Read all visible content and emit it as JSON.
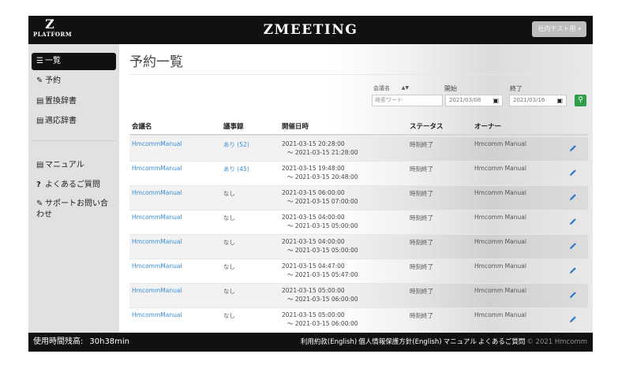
{
  "header": {
    "logo_letter": "Z",
    "logo_sub": "PLATFORM",
    "app_title": "ZMEETING",
    "user_menu_label": "社内テスト用"
  },
  "sidebar": {
    "items": [
      {
        "icon": "list-icon",
        "glyph": "☰",
        "label": "一覧",
        "active": true
      },
      {
        "icon": "pencil-icon",
        "glyph": "✎",
        "label": "予約"
      },
      {
        "icon": "book-icon",
        "glyph": "▤",
        "label": "置換辞書"
      },
      {
        "icon": "book-icon",
        "glyph": "▤",
        "label": "適応辞書"
      },
      {
        "icon": "book-icon",
        "glyph": "▤",
        "label": "マニュアル"
      },
      {
        "icon": "question-icon",
        "glyph": "?",
        "label": "よくあるご質問"
      },
      {
        "icon": "edit-box-icon",
        "glyph": "✎",
        "label": "サポートお問い合わせ"
      }
    ]
  },
  "main": {
    "title": "予約一覧",
    "filters": {
      "field_select": "会議名",
      "keyword_placeholder": "検索ワード",
      "start_label": "開始",
      "start_value": "2021/03/08",
      "end_label": "終了",
      "end_value": "2021/03/16"
    },
    "table": {
      "columns": [
        "会議名",
        "議事録",
        "開催日時",
        "ステータス",
        "オーナー"
      ],
      "rows": [
        {
          "name": "HmcommManual",
          "minutes": "あり (52)",
          "minutes_link": true,
          "start": "2021-03-15 20:28:00",
          "end": "～ 2021-03-15 21:28:00",
          "status": "時刻終了",
          "owner": "Hmcomm Manual"
        },
        {
          "name": "HmcommManual",
          "minutes": "あり (45)",
          "minutes_link": true,
          "start": "2021-03-15 19:48:00",
          "end": "～ 2021-03-15 20:48:00",
          "status": "時刻終了",
          "owner": "Hmcomm Manual"
        },
        {
          "name": "HmcommManual",
          "minutes": "なし",
          "minutes_link": false,
          "start": "2021-03-15 06:00:00",
          "end": "～ 2021-03-15 07:00:00",
          "status": "時刻終了",
          "owner": "Hmcomm Manual"
        },
        {
          "name": "HmcommManual",
          "minutes": "なし",
          "minutes_link": false,
          "start": "2021-03-15 04:00:00",
          "end": "～ 2021-03-15 05:00:00",
          "status": "時刻終了",
          "owner": "Hmcomm Manual"
        },
        {
          "name": "HmcommManual",
          "minutes": "なし",
          "minutes_link": false,
          "start": "2021-03-15 04:00:00",
          "end": "～ 2021-03-15 05:00:00",
          "status": "時刻終了",
          "owner": "Hmcomm Manual"
        },
        {
          "name": "HmcommManual",
          "minutes": "なし",
          "minutes_link": false,
          "start": "2021-03-15 04:47:00",
          "end": "～ 2021-03-15 05:47:00",
          "status": "時刻終了",
          "owner": "Hmcomm Manual"
        },
        {
          "name": "HmcommManual",
          "minutes": "なし",
          "minutes_link": false,
          "start": "2021-03-15 05:00:00",
          "end": "～ 2021-03-15 06:00:00",
          "status": "時刻終了",
          "owner": "Hmcomm Manual"
        },
        {
          "name": "HmcommManual",
          "minutes": "なし",
          "minutes_link": false,
          "start": "2021-03-15 05:00:00",
          "end": "～ 2021-03-15 06:00:00",
          "status": "時刻終了",
          "owner": "Hmcomm Manual"
        }
      ]
    }
  },
  "footer": {
    "remaining_label": "使用時間残高:",
    "remaining_value": "30h38min",
    "links": [
      "利用約款(English)",
      "個人情報保護方針(English)",
      "マニュアル",
      "よくあるご質問"
    ],
    "copyright": "© 2021 Hmcomm"
  },
  "colors": {
    "header_bg": "#111111",
    "sidebar_bg": "#e1e1e1",
    "link": "#3b8ed6",
    "search_button": "#2e9e4c"
  }
}
